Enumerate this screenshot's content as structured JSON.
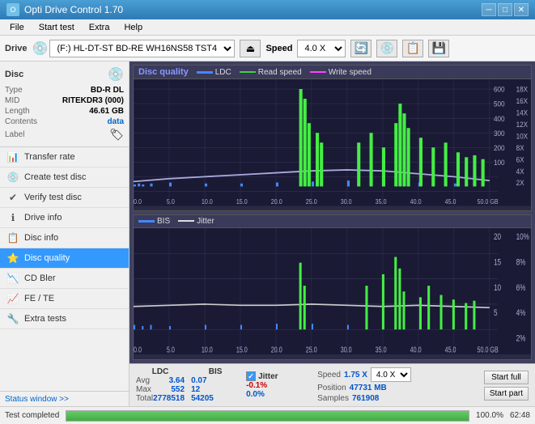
{
  "titleBar": {
    "title": "Opti Drive Control 1.70",
    "minBtn": "─",
    "maxBtn": "□",
    "closeBtn": "✕"
  },
  "menuBar": {
    "items": [
      "File",
      "Start test",
      "Extra",
      "Help"
    ]
  },
  "toolbar": {
    "driveLabel": "Drive",
    "driveValue": "(F:)  HL-DT-ST BD-RE  WH16NS58 TST4",
    "speedLabel": "Speed",
    "speedValue": "4.0 X"
  },
  "disc": {
    "title": "Disc",
    "typeLabel": "Type",
    "typeValue": "BD-R DL",
    "midLabel": "MID",
    "midValue": "RITEKDR3 (000)",
    "lengthLabel": "Length",
    "lengthValue": "46.61 GB",
    "contentsLabel": "Contents",
    "contentsValue": "data",
    "labelLabel": "Label"
  },
  "navItems": [
    {
      "label": "Transfer rate",
      "icon": "📊"
    },
    {
      "label": "Create test disc",
      "icon": "💿"
    },
    {
      "label": "Verify test disc",
      "icon": "✔"
    },
    {
      "label": "Drive info",
      "icon": "ℹ"
    },
    {
      "label": "Disc info",
      "icon": "📋"
    },
    {
      "label": "Disc quality",
      "icon": "⭐",
      "active": true
    },
    {
      "label": "CD Bler",
      "icon": "📉"
    },
    {
      "label": "FE / TE",
      "icon": "📈"
    },
    {
      "label": "Extra tests",
      "icon": "🔧"
    }
  ],
  "statusWindow": "Status window >>",
  "chart1": {
    "title": "Disc quality",
    "legends": [
      "LDC",
      "Read speed",
      "Write speed"
    ],
    "yMax": 600,
    "yMin": 0,
    "yRightLabels": [
      "18X",
      "16X",
      "14X",
      "12X",
      "10X",
      "8X",
      "6X",
      "4X",
      "2X"
    ],
    "xLabels": [
      "0.0",
      "5.0",
      "10.0",
      "15.0",
      "20.0",
      "25.0",
      "30.0",
      "35.0",
      "40.0",
      "45.0",
      "50.0 GB"
    ]
  },
  "chart2": {
    "legends": [
      "BIS",
      "Jitter"
    ],
    "yMax": 20,
    "yMin": 0,
    "yRightLabels": [
      "10%",
      "8%",
      "6%",
      "4%",
      "2%"
    ],
    "xLabels": [
      "0.0",
      "5.0",
      "10.0",
      "15.0",
      "20.0",
      "25.0",
      "30.0",
      "35.0",
      "40.0",
      "45.0",
      "50.0 GB"
    ]
  },
  "stats": {
    "ldcHeader": "LDC",
    "bisHeader": "BIS",
    "jitterHeader": "Jitter",
    "avgLabel": "Avg",
    "maxLabel": "Max",
    "totalLabel": "Total",
    "ldcAvg": "3.64",
    "ldcMax": "552",
    "ldcTotal": "2778518",
    "bisAvg": "0.07",
    "bisMax": "12",
    "bisTotal": "54205",
    "jitterAvg": "-0.1%",
    "jitterMax": "0.0%",
    "speedLabel": "Speed",
    "speedValue": "1.75 X",
    "speedSelectValue": "4.0 X",
    "positionLabel": "Position",
    "positionValue": "47731 MB",
    "samplesLabel": "Samples",
    "samplesValue": "761908",
    "startFull": "Start full",
    "startPart": "Start part"
  },
  "bottomBar": {
    "statusText": "Test completed",
    "progressPercent": 100,
    "progressLabel": "100.0%",
    "time": "62:48"
  }
}
